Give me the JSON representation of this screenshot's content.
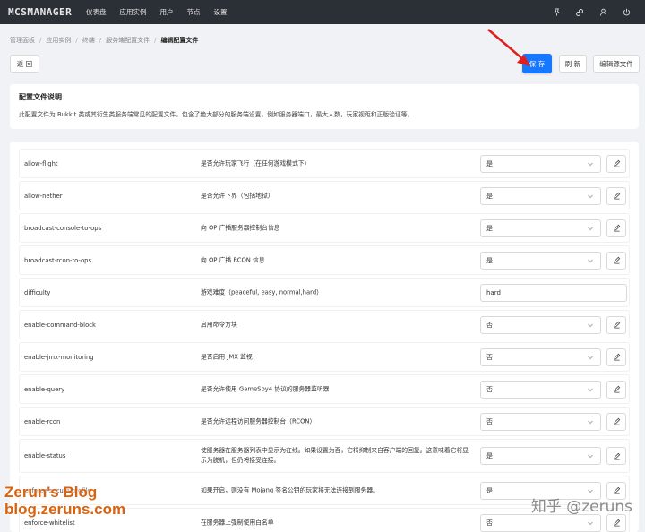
{
  "app": {
    "logo": "MCSMANAGER",
    "nav": [
      "仪表盘",
      "应用实例",
      "用户",
      "节点",
      "设置"
    ],
    "icons": [
      "pin-icon",
      "link-icon",
      "user-icon",
      "power-icon"
    ]
  },
  "breadcrumb": [
    "管理面板",
    "应用实例",
    "终端",
    "服务端配置文件",
    "编辑配置文件"
  ],
  "toolbar": {
    "back": "返 回",
    "save": "保 存",
    "refresh": "刷 新",
    "edit_source": "编辑源文件"
  },
  "info": {
    "title": "配置文件说明",
    "desc": "此配置文件为 Bukkit 类或其衍生类服务端常见的配置文件，包含了绝大部分的服务端设置，例如服务器端口，最大人数，玩家视距和正版验证等。"
  },
  "rows": [
    {
      "key": "allow-flight",
      "desc": "是否允许玩家飞行（在任何游戏模式下）",
      "value": "是",
      "type": "select"
    },
    {
      "key": "allow-nether",
      "desc": "是否允许下界（包括地狱）",
      "value": "是",
      "type": "select"
    },
    {
      "key": "broadcast-console-to-ops",
      "desc": "向 OP 广播服务器控制台信息",
      "value": "是",
      "type": "select"
    },
    {
      "key": "broadcast-rcon-to-ops",
      "desc": "向 OP 广播 RCON 信息",
      "value": "是",
      "type": "select"
    },
    {
      "key": "difficulty",
      "desc": "游戏难度（peaceful, easy, normal,hard）",
      "value": "hard",
      "type": "input"
    },
    {
      "key": "enable-command-block",
      "desc": "启用命令方块",
      "value": "否",
      "type": "select"
    },
    {
      "key": "enable-jmx-monitoring",
      "desc": "是否启用 JMX 监视",
      "value": "否",
      "type": "select"
    },
    {
      "key": "enable-query",
      "desc": "是否允许使用 GameSpy4 协议的服务器监听器",
      "value": "否",
      "type": "select"
    },
    {
      "key": "enable-rcon",
      "desc": "是否允许远程访问服务器控制台（RCON）",
      "value": "否",
      "type": "select"
    },
    {
      "key": "enable-status",
      "desc": "使服务器在服务器列表中显示为在线。如果设置为否，它将抑制来自客户端的回复。这意味着它将显示为脱机，但仍将接受连接。",
      "value": "是",
      "type": "select"
    },
    {
      "key": "enforce-secure-profile",
      "desc": "如果开启，则没有 Mojang 签名公钥的玩家将无法连接到服务器。",
      "value": "是",
      "type": "select"
    },
    {
      "key": "enforce-whitelist",
      "desc": "在服务器上强制使用白名单",
      "value": "否",
      "type": "select"
    }
  ],
  "watermark": {
    "left_line1": "Zerun's Blog",
    "left_line2": "blog.zeruns.com",
    "right": "知乎 @zeruns"
  },
  "colors": {
    "nav_bg": "#2b2f36",
    "primary": "#1677ff",
    "arrow": "#e02020",
    "watermark": "#d9620f"
  }
}
